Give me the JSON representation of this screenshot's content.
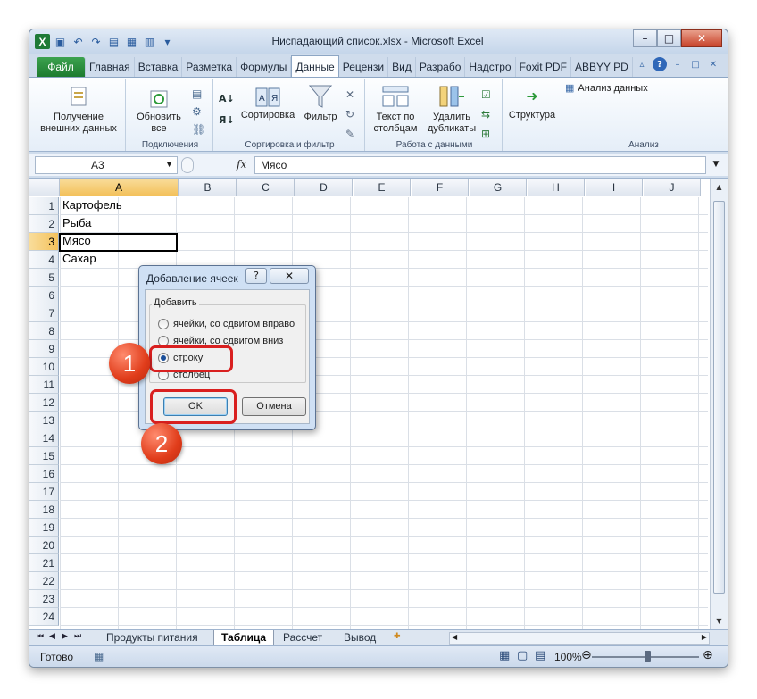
{
  "window": {
    "title": "Ниспадающий список.xlsx - Microsoft Excel"
  },
  "tabs": [
    "Файл",
    "Главная",
    "Вставка",
    "Разметка",
    "Формулы",
    "Данные",
    "Рецензи",
    "Вид",
    "Разрабо",
    "Надстро",
    "Foxit PDF",
    "ABBYY PD"
  ],
  "ribbon": {
    "get_external": "Получение внешних данных",
    "refresh_all": "Обновить все",
    "group_connections": "Подключения",
    "sort": "Сортировка",
    "filter": "Фильтр",
    "group_sort": "Сортировка и фильтр",
    "text_to_cols": "Текст по столбцам",
    "remove_dup": "Удалить дубликаты",
    "group_tools": "Работа с данными",
    "outline": "Структура",
    "analysis": "Анализ данных",
    "group_analysis": "Анализ"
  },
  "formula_bar": {
    "name_box": "A3",
    "fx": "fx",
    "value": "Мясо"
  },
  "columns": [
    "A",
    "B",
    "C",
    "D",
    "E",
    "F",
    "G",
    "H",
    "I",
    "J"
  ],
  "rows": [
    "1",
    "2",
    "3",
    "4",
    "5",
    "6",
    "7",
    "8",
    "9",
    "10",
    "11",
    "12",
    "13",
    "14",
    "15",
    "16",
    "17",
    "18",
    "19",
    "20",
    "21",
    "22",
    "23",
    "24"
  ],
  "cells": {
    "A1": "Картофель",
    "A2": "Рыба",
    "A3": "Мясо",
    "A4": "Сахар"
  },
  "sheets": [
    "Продукты питания",
    "Таблица",
    "Рассчет",
    "Вывод"
  ],
  "status": {
    "ready": "Готово",
    "zoom": "100%"
  },
  "dialog": {
    "title": "Добавление ячеек",
    "help": "?",
    "close": "✕",
    "group": "Добавить",
    "options": [
      "ячейки, со сдвигом вправо",
      "ячейки, со сдвигом вниз",
      "строку",
      "столбец"
    ],
    "selected": "строку",
    "ok": "OK",
    "cancel": "Отмена"
  },
  "badges": [
    "1",
    "2"
  ],
  "colors": {
    "accent": "#1d7b2f",
    "highlight": "#d92020"
  }
}
